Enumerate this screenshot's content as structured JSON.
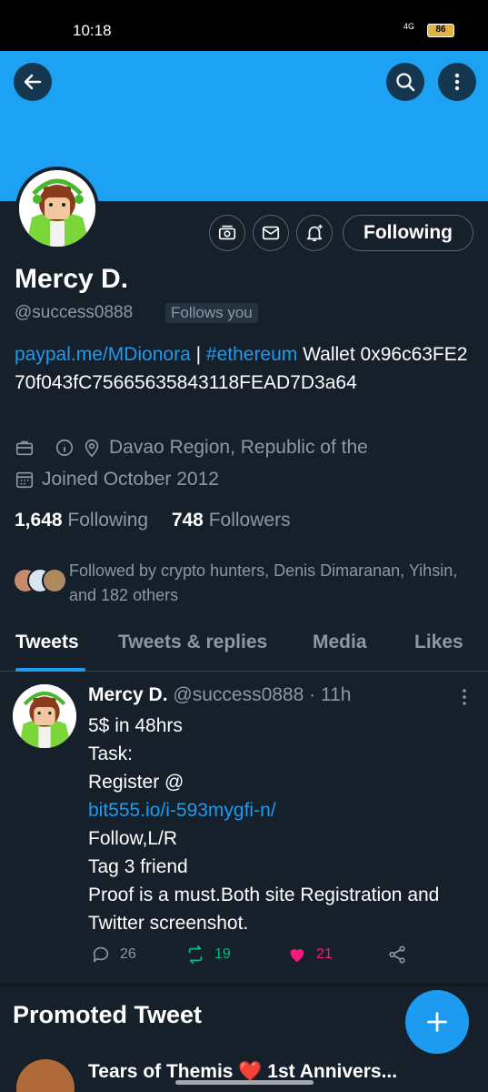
{
  "status_bar": {
    "time": "10:18",
    "network": "4G",
    "battery": "86"
  },
  "header": {
    "back_icon": "arrow-left-icon",
    "search_icon": "search-icon",
    "more_icon": "more-vertical-icon",
    "banner_color": "#1da1f2"
  },
  "profile": {
    "name": "Mercy D.",
    "handle": "@success0888",
    "follows_you": "Follows you",
    "following_button": "Following",
    "action_icons": [
      "tip-jar-icon",
      "mail-icon",
      "bell-plus-icon"
    ],
    "bio": {
      "link1": "paypal.me/MDionora",
      "sep": " | ",
      "hashtag": "#ethereum",
      "text": " Wallet 0x96c63FE270f043fC75665635843118FEAD7D3a64"
    },
    "location": "Davao Region, Republic of the",
    "joined": "Joined October 2012",
    "following_count": "1,648",
    "following_label": "Following",
    "followers_count": "748",
    "followers_label": "Followers",
    "followed_by": "Followed by crypto hunters, Denis Dimaranan, Yihsin, and 182 others"
  },
  "tabs": [
    {
      "label": "Tweets",
      "active": true
    },
    {
      "label": "Tweets & replies",
      "active": false
    },
    {
      "label": "Media",
      "active": false
    },
    {
      "label": "Likes",
      "active": false
    }
  ],
  "tweet": {
    "name": "Mercy D.",
    "handle": "@success0888",
    "time": "· 11h",
    "lines": [
      "5$ in 48hrs",
      "Task:",
      "Register @",
      "bit555.io/i-593mygfi-n/",
      "Follow,L/R",
      "Tag 3 friend",
      "Proof is a must.Both site Registration and  Twitter screenshot."
    ],
    "replies": "26",
    "retweets": "19",
    "likes": "21"
  },
  "promoted": {
    "title": "Promoted Tweet",
    "next_tweet_head": "Tears of Themis ❤️ 1st Annivers..."
  },
  "fab": {
    "icon": "plus-icon"
  },
  "colors": {
    "accent": "#1d9bf0",
    "retweet": "#00ba7c",
    "like": "#f91880"
  }
}
